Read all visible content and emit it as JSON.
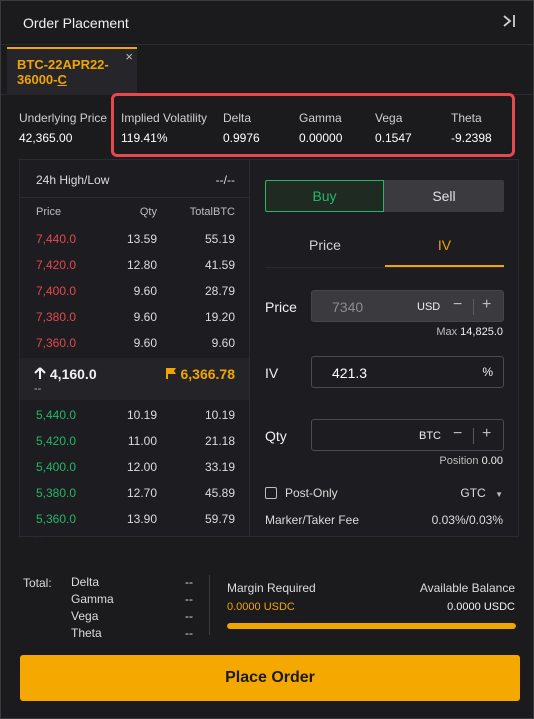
{
  "header": {
    "title": "Order Placement",
    "collapse_icon": "collapse-right-icon"
  },
  "tab": {
    "label_line1": "BTC-22APR22-",
    "label_line2": "36000-",
    "label_suffix": "C",
    "close": "×"
  },
  "stats": [
    {
      "label": "Underlying Price",
      "value": "42,365.00"
    },
    {
      "label": "Implied Volatility",
      "value": "119.41%"
    },
    {
      "label": "Delta",
      "value": "0.9976"
    },
    {
      "label": "Gamma",
      "value": "0.00000"
    },
    {
      "label": "Vega",
      "value": "0.1547"
    },
    {
      "label": "Theta",
      "value": "-9.2398"
    }
  ],
  "orderbook": {
    "title": "24h High/Low",
    "range": "--/--",
    "columns": [
      "Price",
      "Qty",
      "TotalBTC"
    ],
    "asks": [
      {
        "price": "7,440.0",
        "qty": "13.59",
        "total": "55.19"
      },
      {
        "price": "7,420.0",
        "qty": "12.80",
        "total": "41.59"
      },
      {
        "price": "7,400.0",
        "qty": "9.60",
        "total": "28.79"
      },
      {
        "price": "7,380.0",
        "qty": "9.60",
        "total": "19.20"
      },
      {
        "price": "7,360.0",
        "qty": "9.60",
        "total": "9.60"
      }
    ],
    "last_price": "4,160.0",
    "mark_price": "6,366.78",
    "mid_sub": "--",
    "bids": [
      {
        "price": "5,440.0",
        "qty": "10.19",
        "total": "10.19"
      },
      {
        "price": "5,420.0",
        "qty": "11.00",
        "total": "21.18"
      },
      {
        "price": "5,400.0",
        "qty": "12.00",
        "total": "33.19"
      },
      {
        "price": "5,380.0",
        "qty": "12.70",
        "total": "45.89"
      },
      {
        "price": "5,360.0",
        "qty": "13.90",
        "total": "59.79"
      }
    ]
  },
  "form": {
    "buy": "Buy",
    "sell": "Sell",
    "mode_price": "Price",
    "mode_iv": "IV",
    "price_label": "Price",
    "price_value": "7340",
    "price_unit": "USD",
    "price_hint_label": "Max",
    "price_hint_value": "14,825.0",
    "iv_label": "IV",
    "iv_value": "421.3",
    "iv_unit": "%",
    "qty_label": "Qty",
    "qty_value": "",
    "qty_unit": "BTC",
    "qty_hint_label": "Position",
    "qty_hint_value": "0.00",
    "post_only": "Post-Only",
    "tif": "GTC",
    "fee_label": "Marker/Taker Fee",
    "fee_value": "0.03%/0.03%"
  },
  "total": {
    "label": "Total:",
    "greeks": [
      {
        "name": "Delta",
        "value": "--"
      },
      {
        "name": "Gamma",
        "value": "--"
      },
      {
        "name": "Vega",
        "value": "--"
      },
      {
        "name": "Theta",
        "value": "--"
      }
    ],
    "margin_label": "Margin Required",
    "margin_value": "0.0000 USDC",
    "balance_label": "Available Balance",
    "balance_value": "0.0000 USDC",
    "margin_usage_fraction": 1.0
  },
  "place_order": "Place Order",
  "colors": {
    "accent": "#f0a500",
    "buy": "#22b965",
    "sell": "#e5484d",
    "highlight": "#e5484d"
  }
}
